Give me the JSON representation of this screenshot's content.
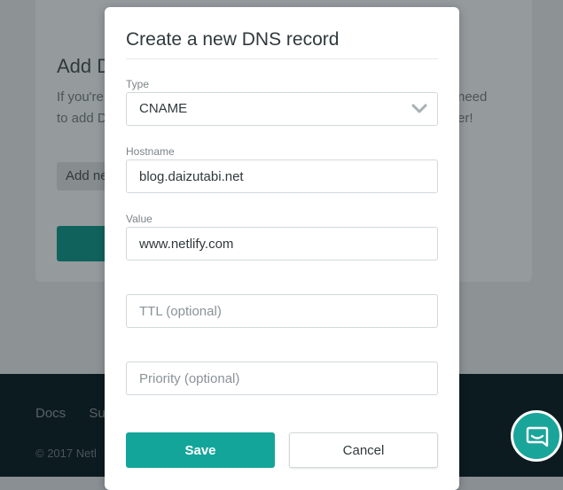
{
  "background": {
    "heading": "Add D",
    "text_line1": "If you're",
    "text_line2": "to add D",
    "text_right1": "need",
    "text_right2": "er!",
    "chip_label": "Add ne",
    "footer_links": [
      "Docs",
      "Su"
    ],
    "footer_copy": "© 2017 Netl"
  },
  "modal": {
    "title": "Create a new DNS record",
    "type": {
      "label": "Type",
      "value": "CNAME"
    },
    "hostname": {
      "label": "Hostname",
      "value": "blog.daizutabi.net"
    },
    "value": {
      "label": "Value",
      "value": "www.netlify.com"
    },
    "ttl": {
      "placeholder": "TTL (optional)"
    },
    "priority": {
      "placeholder": "Priority (optional)"
    },
    "save_label": "Save",
    "cancel_label": "Cancel"
  },
  "colors": {
    "accent": "#13a59a",
    "text": "#30393c"
  },
  "icons": {
    "select": "chevron-down-icon",
    "chat": "chat-icon"
  }
}
